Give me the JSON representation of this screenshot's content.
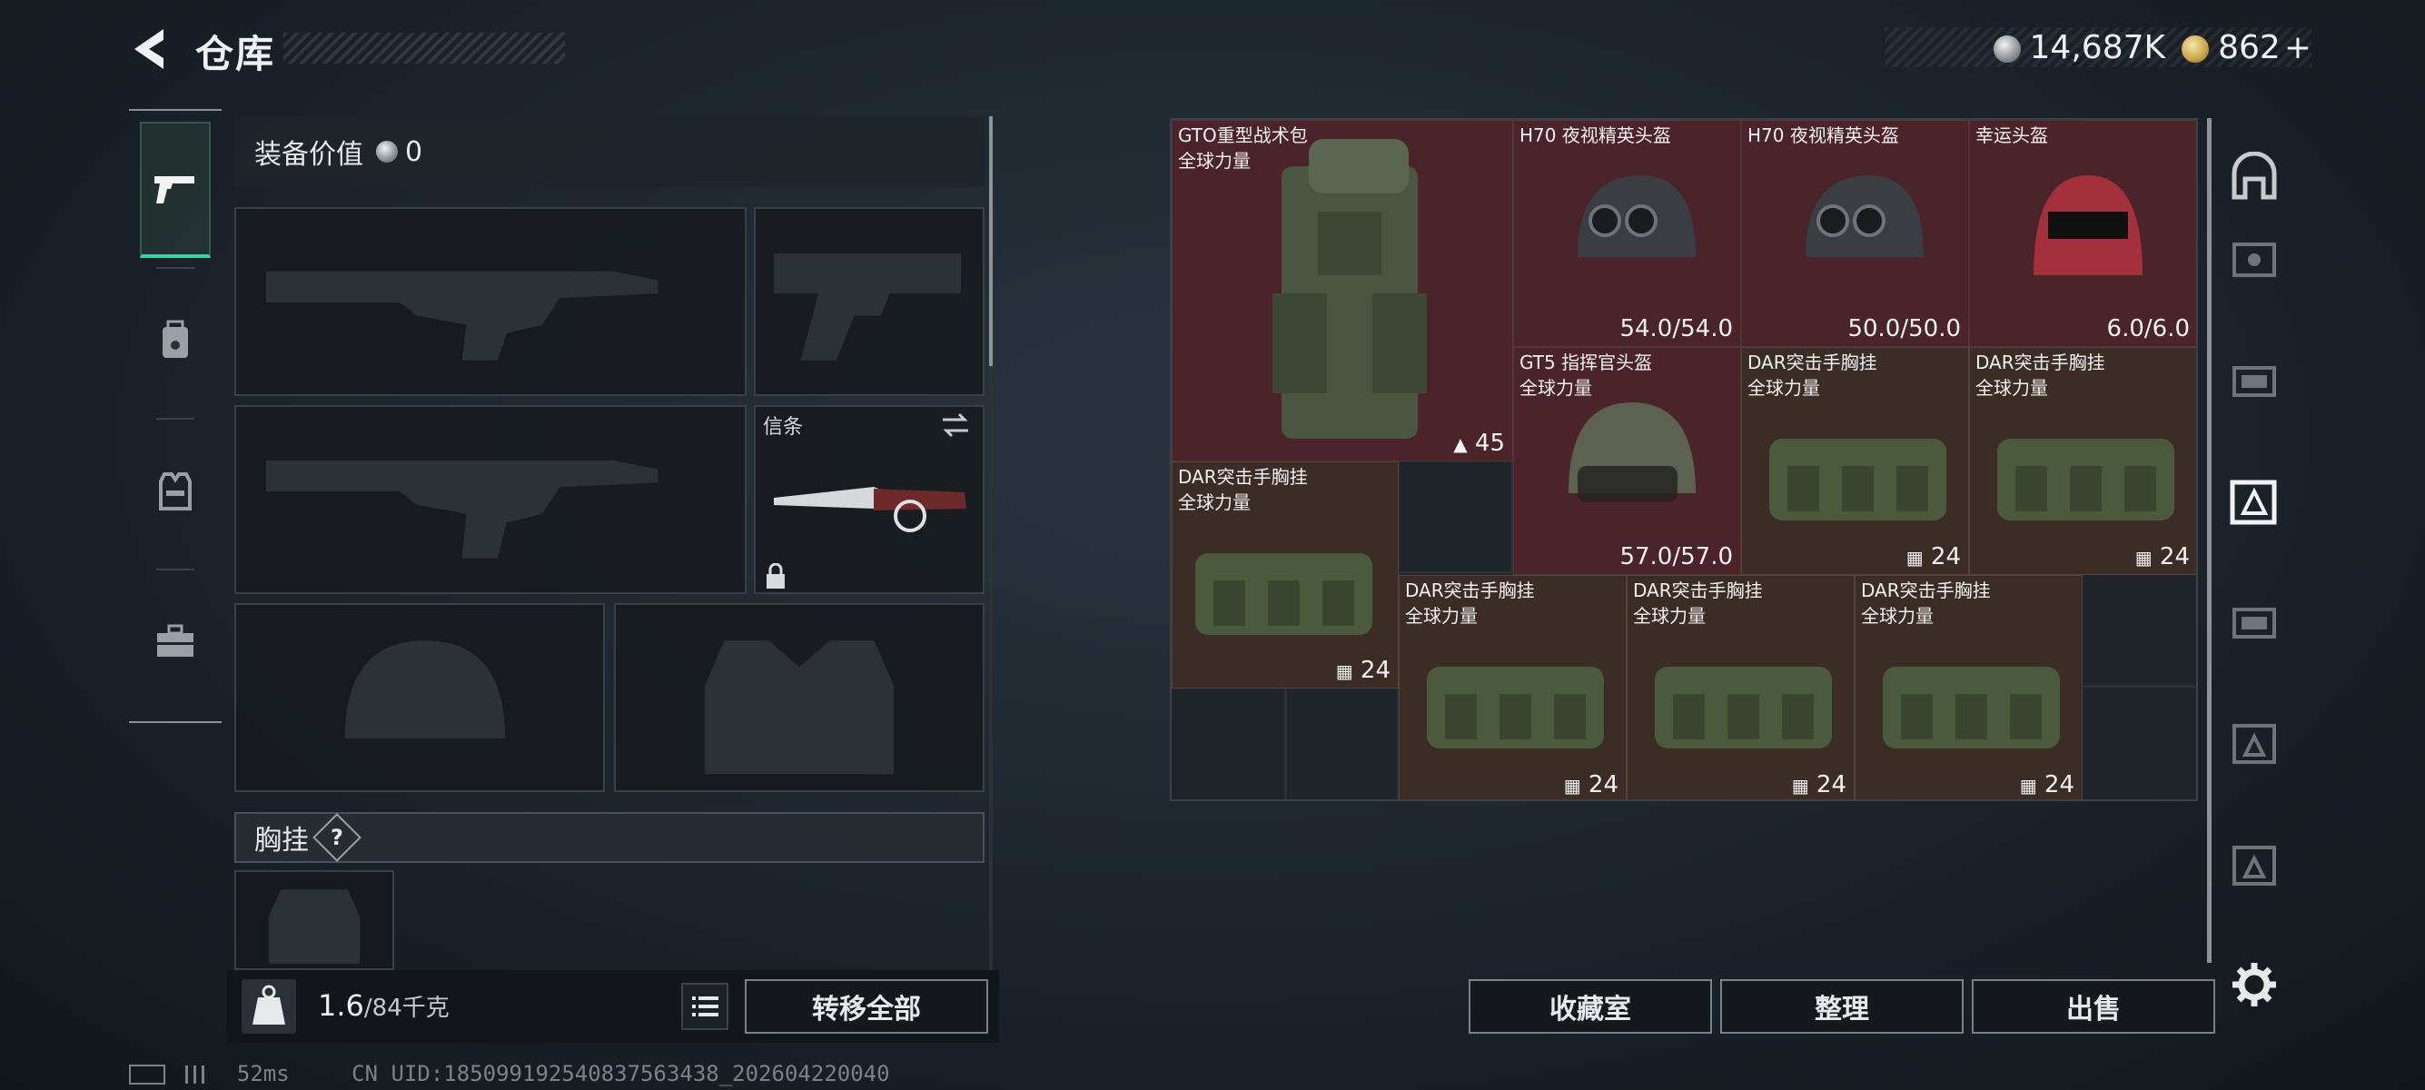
{
  "header": {
    "title": "仓库",
    "currency_silver": "14,687K",
    "currency_gold": "862",
    "currency_plus": "+"
  },
  "left_nav": {
    "items": [
      "pistol-icon",
      "backpack-icon",
      "vest-icon",
      "toolbox-icon"
    ]
  },
  "equipment": {
    "value_label": "装备价值",
    "value": "0",
    "melee_label": "信条",
    "rig_label": "胸挂",
    "rig_help": "?"
  },
  "weight": {
    "current": "1.6",
    "max": "/84千克",
    "transfer_all": "转移全部"
  },
  "status": {
    "ping": "52ms",
    "uid": "CN UID:185099192540837563438_202604220040"
  },
  "stash": {
    "items": [
      {
        "name": "GTO重型战术包",
        "sub": "全球力量",
        "value": "45",
        "value_icon": "weight-icon"
      },
      {
        "name": "H70 夜视精英头盔",
        "value": "54.0/54.0"
      },
      {
        "name": "H70 夜视精英头盔",
        "value": "50.0/50.0"
      },
      {
        "name": "幸运头盔",
        "value": "6.0/6.0"
      },
      {
        "name": "GT5 指挥官头盔",
        "sub": "全球力量",
        "value": "57.0/57.0"
      },
      {
        "name": "DAR突击手胸挂",
        "sub": "全球力量",
        "value": "24",
        "value_icon": "capacity-icon"
      },
      {
        "name": "DAR突击手胸挂",
        "sub": "全球力量",
        "value": "24",
        "value_icon": "capacity-icon"
      },
      {
        "name": "DAR突击手胸挂",
        "sub": "全球力量",
        "value": "24",
        "value_icon": "capacity-icon"
      },
      {
        "name": "DAR突击手胸挂",
        "sub": "全球力量",
        "value": "24",
        "value_icon": "capacity-icon"
      },
      {
        "name": "DAR突击手胸挂",
        "sub": "全球力量",
        "value": "24",
        "value_icon": "capacity-icon"
      },
      {
        "name": "DAR突击手胸挂",
        "sub": "全球力量",
        "value": "24",
        "value_icon": "capacity-icon"
      }
    ]
  },
  "actions": {
    "collection": "收藏室",
    "sort": "整理",
    "sell": "出售"
  },
  "colors": {
    "accent": "#3fd1a6",
    "rarity_red": "#4a232b",
    "rarity_brown": "#3b2c26"
  }
}
